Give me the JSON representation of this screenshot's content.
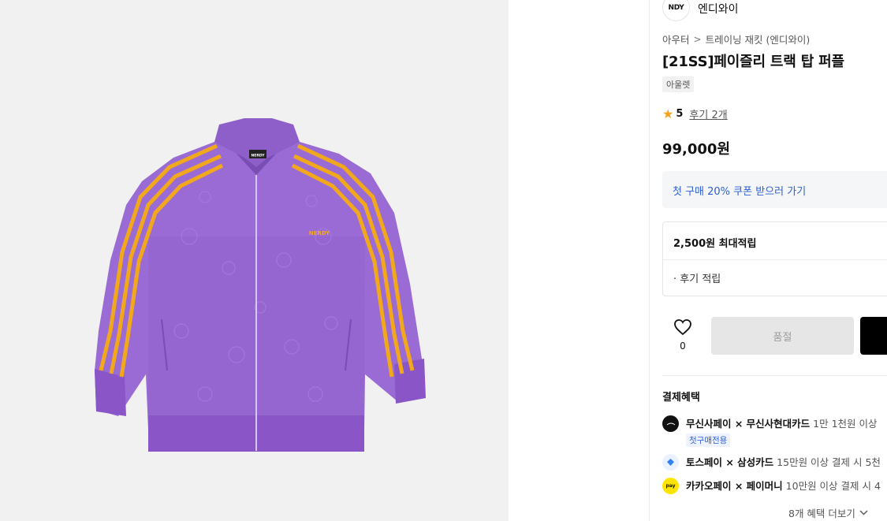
{
  "brand": {
    "logo_text": "NDY",
    "name": "엔디와이"
  },
  "breadcrumb": {
    "items": [
      "아우터",
      "트레이닝 재킷 (엔디와이)"
    ],
    "separator": ">"
  },
  "product": {
    "title": "[21SS]페이즐리 트랙 탑 퍼플",
    "badge": "아울렛",
    "rating": {
      "score": "5",
      "reviews_label": "후기 2개"
    },
    "price": "99,000원",
    "jacket_chest_logo": "NERDY",
    "jacket_label": "NERDY"
  },
  "coupon": {
    "label": "첫 구매 20% 쿠폰 받으러 가기"
  },
  "points": {
    "max_label": "2,500원 최대적립",
    "review_label": "· 후기 적립"
  },
  "actions": {
    "like_count": "0",
    "soldout_label": "품절"
  },
  "benefits": {
    "title": "결제혜택",
    "rows": [
      {
        "name": "무신사페이 × 무신사현대카드",
        "desc": " 1만 1천원 이상 ",
        "tag": "첫구매전용",
        "icon": "musinsa-pay-icon"
      },
      {
        "name": "토스페이 × 삼성카드",
        "desc": " 15만원 이상 결제 시 5천",
        "icon": "toss-pay-icon"
      },
      {
        "name": "카카오페이 × 페이머니",
        "desc": " 10만원 이상 결제 시 4",
        "icon": "kakao-pay-icon",
        "icon_text": "pay"
      }
    ],
    "more_label": "8개 혜택 더보기"
  },
  "colors": {
    "accent_blue": "#2a5fd7",
    "jacket_purple": "#9a6bd4",
    "stripe_yellow": "#f2a81d",
    "kakao_yellow": "#fee500"
  }
}
